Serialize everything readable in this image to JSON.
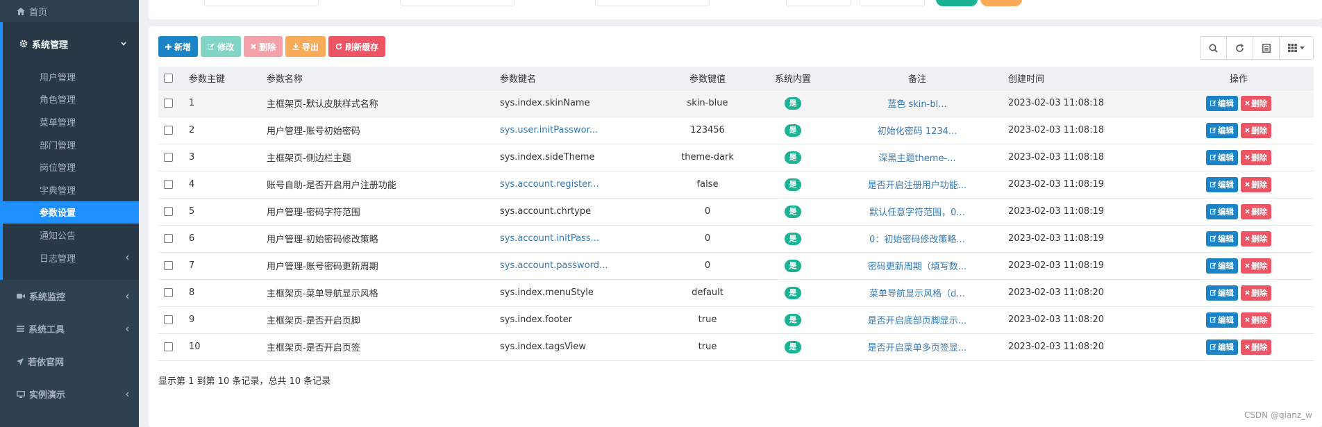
{
  "sidebar": {
    "home": {
      "label": "首页",
      "icon": "home-icon"
    },
    "system_group": {
      "label": "系统管理",
      "icon": "gear-icon"
    },
    "sub_items": [
      {
        "label": "用户管理"
      },
      {
        "label": "角色管理"
      },
      {
        "label": "菜单管理"
      },
      {
        "label": "部门管理"
      },
      {
        "label": "岗位管理"
      },
      {
        "label": "字典管理"
      },
      {
        "label": "参数设置",
        "active": true
      },
      {
        "label": "通知公告"
      },
      {
        "label": "日志管理",
        "has_children": true
      }
    ],
    "items": [
      {
        "label": "系统监控",
        "icon": "video-icon",
        "has_children": true
      },
      {
        "label": "系统工具",
        "icon": "bars-icon",
        "has_children": true
      },
      {
        "label": "若依官网",
        "icon": "send-icon",
        "has_children": false
      },
      {
        "label": "实例演示",
        "icon": "desktop-icon",
        "has_children": true
      }
    ]
  },
  "toolbar": {
    "add_label": "新增",
    "edit_label": "修改",
    "delete_label": "删除",
    "export_label": "导出",
    "refresh_cache_label": "刷新缓存"
  },
  "table": {
    "headers": [
      "参数主键",
      "参数名称",
      "参数键名",
      "参数键值",
      "系统内置",
      "备注",
      "创建时间",
      "操作"
    ],
    "rows": [
      {
        "id": "1",
        "name": "主框架页-默认皮肤样式名称",
        "key": "sys.index.skinName",
        "key_link": false,
        "value": "skin-blue",
        "builtin": "是",
        "remark": "蓝色 skin-bl...",
        "time": "2023-02-03 11:08:18"
      },
      {
        "id": "2",
        "name": "用户管理-账号初始密码",
        "key": "sys.user.initPasswor...",
        "key_link": true,
        "value": "123456",
        "builtin": "是",
        "remark": "初始化密码 1234...",
        "time": "2023-02-03 11:08:18"
      },
      {
        "id": "3",
        "name": "主框架页-侧边栏主题",
        "key": "sys.index.sideTheme",
        "key_link": false,
        "value": "theme-dark",
        "builtin": "是",
        "remark": "深黑主题theme-...",
        "time": "2023-02-03 11:08:18"
      },
      {
        "id": "4",
        "name": "账号自助-是否开启用户注册功能",
        "key": "sys.account.register...",
        "key_link": true,
        "value": "false",
        "builtin": "是",
        "remark": "是否开启注册用户功能...",
        "time": "2023-02-03 11:08:19"
      },
      {
        "id": "5",
        "name": "用户管理-密码字符范围",
        "key": "sys.account.chrtype",
        "key_link": false,
        "value": "0",
        "builtin": "是",
        "remark": "默认任意字符范围，0...",
        "time": "2023-02-03 11:08:19"
      },
      {
        "id": "6",
        "name": "用户管理-初始密码修改策略",
        "key": "sys.account.initPass...",
        "key_link": true,
        "value": "0",
        "builtin": "是",
        "remark": "0：初始密码修改策略...",
        "time": "2023-02-03 11:08:19"
      },
      {
        "id": "7",
        "name": "用户管理-账号密码更新周期",
        "key": "sys.account.password...",
        "key_link": true,
        "value": "0",
        "builtin": "是",
        "remark": "密码更新周期（填写数...",
        "time": "2023-02-03 11:08:19"
      },
      {
        "id": "8",
        "name": "主框架页-菜单导航显示风格",
        "key": "sys.index.menuStyle",
        "key_link": false,
        "value": "default",
        "builtin": "是",
        "remark": "菜单导航显示风格（d...",
        "time": "2023-02-03 11:08:20"
      },
      {
        "id": "9",
        "name": "主框架页-是否开启页脚",
        "key": "sys.index.footer",
        "key_link": false,
        "value": "true",
        "builtin": "是",
        "remark": "是否开启底部页脚显示...",
        "time": "2023-02-03 11:08:20"
      },
      {
        "id": "10",
        "name": "主框架页-是否开启页签",
        "key": "sys.index.tagsView",
        "key_link": false,
        "value": "true",
        "builtin": "是",
        "remark": "是否开启菜单多页签显...",
        "time": "2023-02-03 11:08:20"
      }
    ],
    "edit_label": "编辑",
    "delete_label": "删除"
  },
  "pagination": {
    "info": "显示第 1 到第 10 条记录，总共 10 条记录"
  },
  "watermark": "CSDN @qianz_w",
  "colors": {
    "sidebar_bg": "#2f4050",
    "active_item": "#1e90ff",
    "primary": "#1c84c6",
    "success": "#1ab394",
    "warning": "#f8ac59",
    "danger": "#ed5565"
  }
}
